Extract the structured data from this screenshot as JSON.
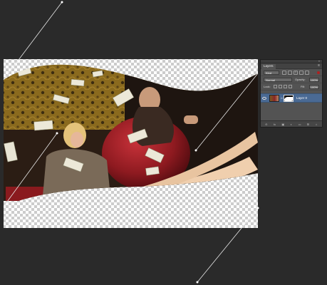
{
  "layers_panel": {
    "tab": "Layers",
    "kind_filter": "Kind",
    "blend_mode": "Normal",
    "opacity_label": "Opacity:",
    "opacity_value": "100%",
    "lock_label": "Lock:",
    "fill_label": "Fill:",
    "fill_value": "100%",
    "layers": [
      {
        "name": "Layer 0",
        "selected": true,
        "visible": true
      }
    ],
    "footer_icons": [
      "link-icon",
      "fx-icon",
      "mask-icon",
      "adjustment-icon",
      "folder-icon",
      "new-layer-icon",
      "trash-icon"
    ]
  },
  "colors": {
    "workspace": "#2a2a2a",
    "panel": "#535353",
    "selected_layer": "#4a6a94"
  }
}
